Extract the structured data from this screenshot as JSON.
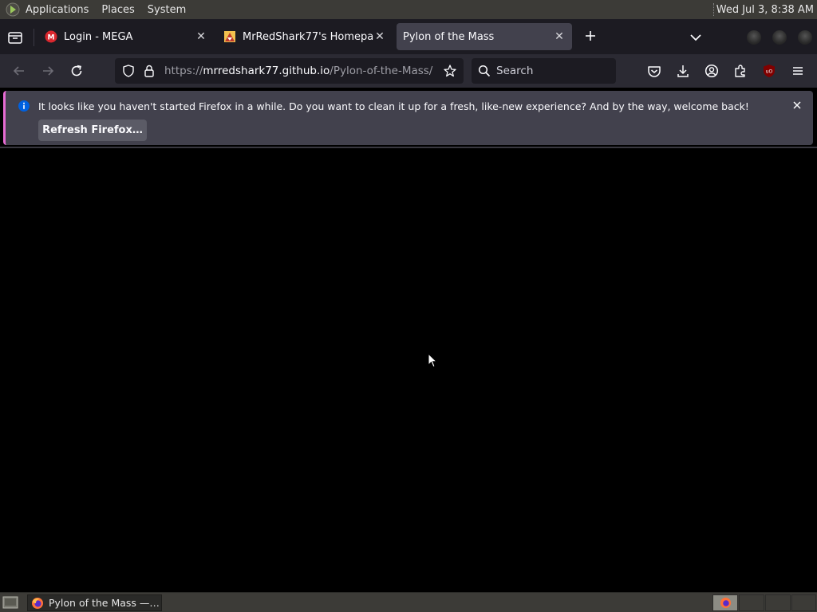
{
  "top_panel": {
    "menus": [
      "Applications",
      "Places",
      "System"
    ],
    "clock": "Wed Jul  3,  8:38 AM"
  },
  "tabs": [
    {
      "title": "Login - MEGA",
      "favicon": "mega-icon",
      "active": false
    },
    {
      "title": "MrRedShark77's Homepage",
      "favicon": "site-icon",
      "active": false
    },
    {
      "title": "Pylon of the Mass",
      "favicon": "",
      "active": true
    }
  ],
  "nav": {
    "url_prefix": "https://",
    "url_host": "mrredshark77.github.io",
    "url_path": "/Pylon-of-the-Mass/",
    "search_placeholder": "Search"
  },
  "notification": {
    "message": "It looks like you haven't started Firefox in a while. Do you want to clean it up for a fresh, like-new experience? And by the way, welcome back!",
    "button_label": "Refresh Firefox…"
  },
  "taskbar": {
    "window_label": "Pylon of the Mass —…"
  },
  "colors": {
    "accent_notification_bar": "#e66bd2",
    "info_icon": "#0060df",
    "mega_red": "#d9272e",
    "ublock_red": "#800000"
  }
}
